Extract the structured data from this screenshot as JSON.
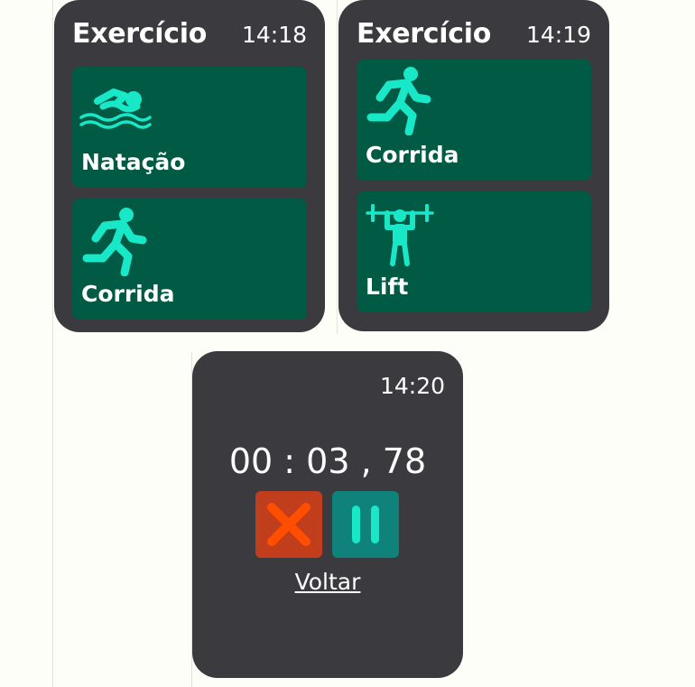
{
  "screens": [
    {
      "title": "Exercício",
      "time": "14:18",
      "cards": [
        {
          "label": "Natação",
          "icon": "swimmer-icon"
        },
        {
          "label": "Corrida",
          "icon": "runner-icon"
        }
      ]
    },
    {
      "title": "Exercício",
      "time": "14:19",
      "cards": [
        {
          "label": "Corrida",
          "icon": "runner-icon"
        },
        {
          "label": "Lift",
          "icon": "weightlifter-icon"
        }
      ]
    }
  ],
  "stopwatch": {
    "time": "14:20",
    "elapsed": "00 : 03 , 78",
    "cancel_icon": "close-icon",
    "pause_icon": "pause-icon",
    "back_label": "Voltar"
  },
  "colors": {
    "background": "#fefef9",
    "watch": "#3b3a3f",
    "card": "#005a44",
    "icon": "#18e8c8",
    "cancel_button": "#c13e1c",
    "cancel_icon": "#ff4e00",
    "pause_button": "#0f827b"
  }
}
